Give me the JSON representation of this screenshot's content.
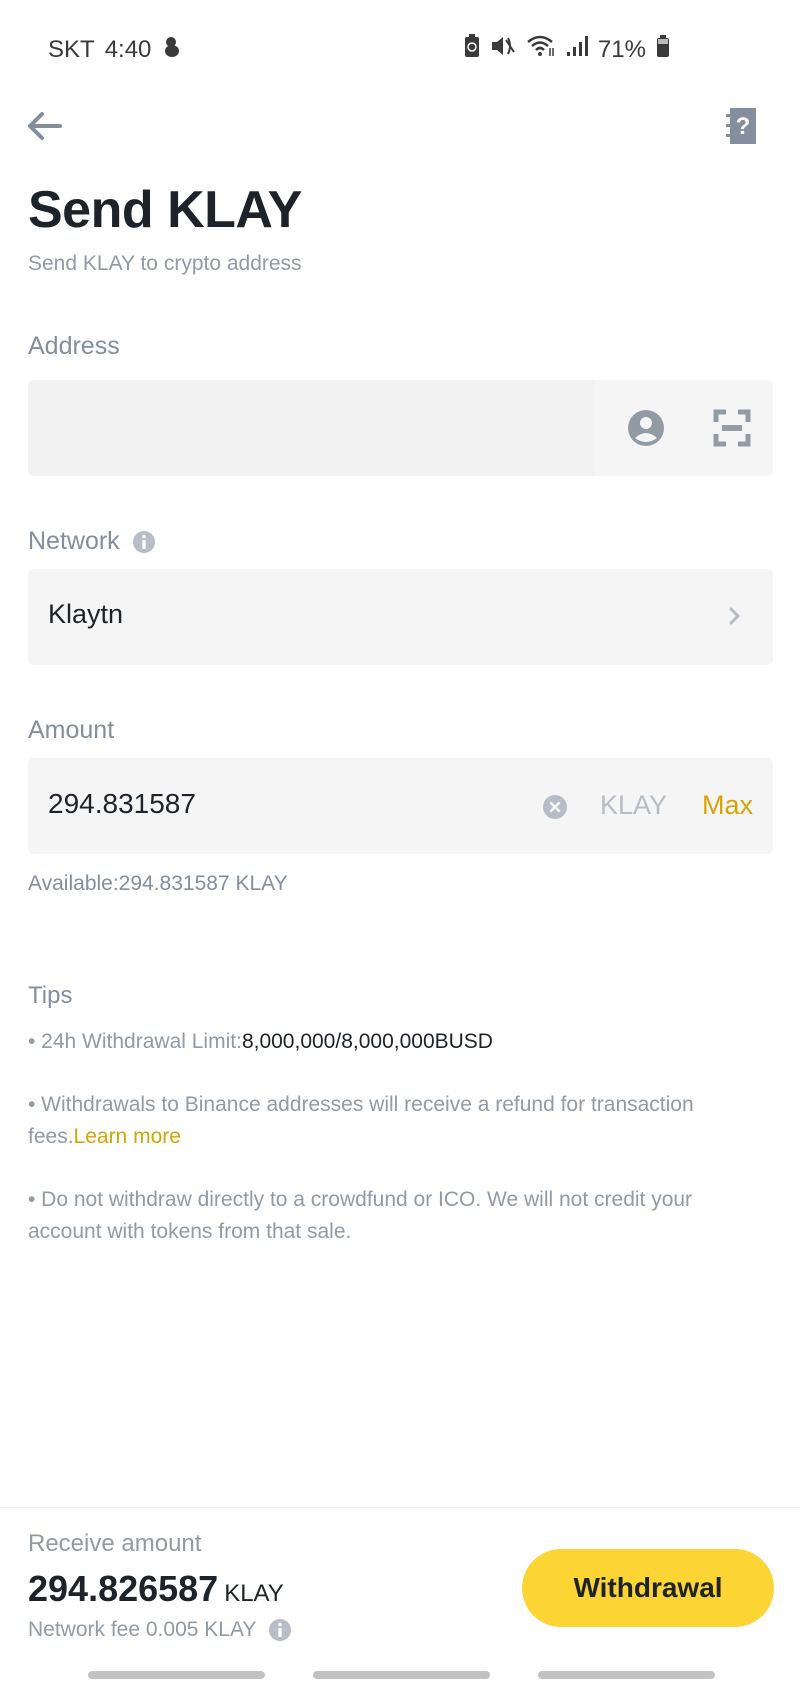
{
  "status_bar": {
    "carrier": "SKT",
    "time": "4:40",
    "battery_percent": "71%"
  },
  "header": {
    "back_icon": "arrow-left-icon",
    "help_icon": "help-document-icon"
  },
  "page": {
    "title": "Send KLAY",
    "subtitle": "Send KLAY to crypto address"
  },
  "address": {
    "label": "Address",
    "value": "",
    "placeholder": ""
  },
  "network": {
    "label": "Network",
    "value": "Klaytn"
  },
  "amount": {
    "label": "Amount",
    "value": "294.831587",
    "unit": "KLAY",
    "max_label": "Max",
    "available_text": "Available:294.831587 KLAY"
  },
  "tips": {
    "title": "Tips",
    "items": [
      {
        "prefix": "• 24h Withdrawal Limit:",
        "highlight": "8,000,000/8,000,000BUSD"
      },
      {
        "text": "• Withdrawals to Binance addresses will receive a refund for transaction fees.",
        "link": "Learn more"
      },
      {
        "text": "• Do not withdraw directly to a crowdfund or ICO. We will not credit your account with tokens from that sale."
      }
    ]
  },
  "footer": {
    "receive_label": "Receive amount",
    "receive_amount": "294.826587",
    "receive_unit": "KLAY",
    "fee_text": "Network fee 0.005 KLAY",
    "withdraw_label": "Withdrawal"
  },
  "colors": {
    "accent": "#fcd535",
    "link": "#d6a30a",
    "text_primary": "#1e2329",
    "text_secondary": "#848e9c"
  }
}
